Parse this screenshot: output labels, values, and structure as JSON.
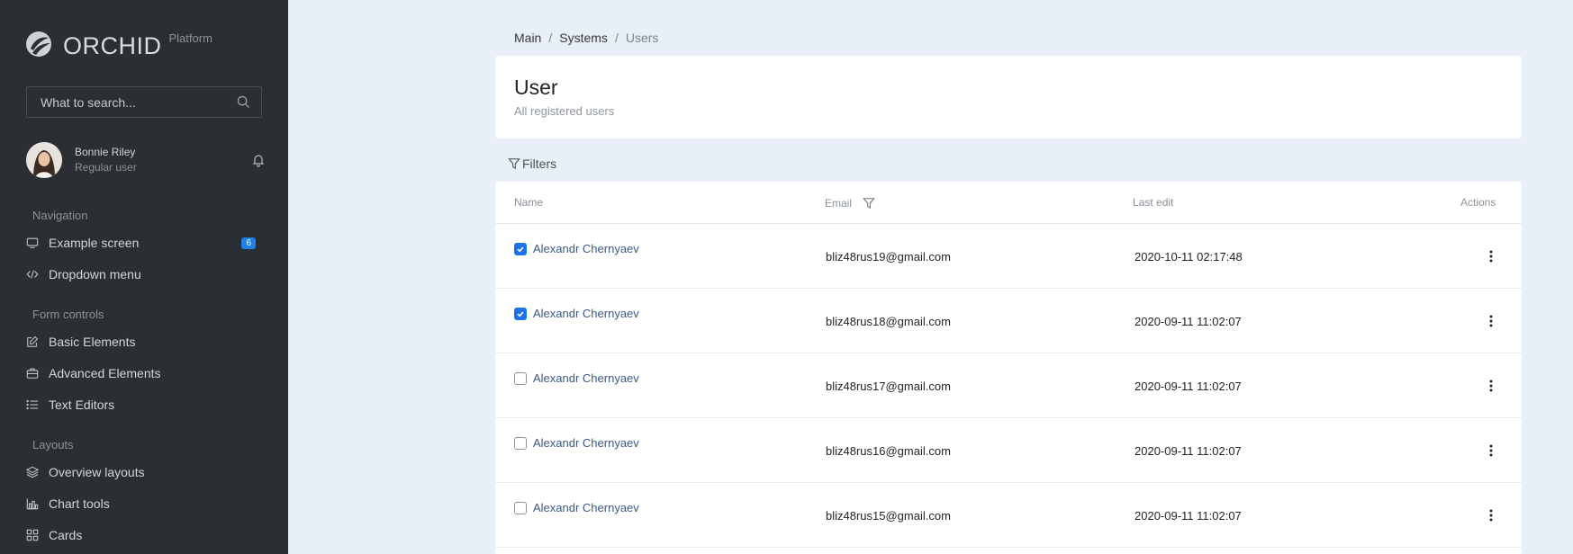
{
  "brand": {
    "name": "ORCHID",
    "sub": "Platform"
  },
  "search": {
    "placeholder": "What to search..."
  },
  "profile": {
    "name": "Bonnie Riley",
    "role": "Regular user"
  },
  "nav": {
    "section_navigation": "Navigation",
    "example_screen": "Example screen",
    "example_badge": "6",
    "dropdown_menu": "Dropdown menu",
    "section_forms": "Form controls",
    "basic_elements": "Basic Elements",
    "advanced_elements": "Advanced Elements",
    "text_editors": "Text Editors",
    "section_layouts": "Layouts",
    "overview_layouts": "Overview layouts",
    "chart_tools": "Chart tools",
    "cards": "Cards"
  },
  "breadcrumb": {
    "main": "Main",
    "systems": "Systems",
    "users": "Users",
    "separator": "/"
  },
  "header": {
    "title": "User",
    "subtitle": "All registered users"
  },
  "filters_label": "Filters",
  "table": {
    "columns": {
      "name": "Name",
      "email": "Email",
      "last_edit": "Last edit",
      "actions": "Actions"
    },
    "rows": [
      {
        "name": "Alexandr Chernyaev",
        "email": "bliz48rus19@gmail.com",
        "last_edit": "2020-10-11 02:17:48",
        "checked": true
      },
      {
        "name": "Alexandr Chernyaev",
        "email": "bliz48rus18@gmail.com",
        "last_edit": "2020-09-11 11:02:07",
        "checked": true
      },
      {
        "name": "Alexandr Chernyaev",
        "email": "bliz48rus17@gmail.com",
        "last_edit": "2020-09-11 11:02:07",
        "checked": false
      },
      {
        "name": "Alexandr Chernyaev",
        "email": "bliz48rus16@gmail.com",
        "last_edit": "2020-09-11 11:02:07",
        "checked": false
      },
      {
        "name": "Alexandr Chernyaev",
        "email": "bliz48rus15@gmail.com",
        "last_edit": "2020-09-11 11:02:07",
        "checked": false
      }
    ]
  },
  "colors": {
    "sidebar_bg": "#2b2f33",
    "page_bg": "#e9eff6",
    "accent": "#1a73e8",
    "badge": "#1f80e6"
  },
  "icons": [
    "orchid-logo-icon",
    "search-icon",
    "bell-icon",
    "monitor-icon",
    "code-icon",
    "edit-icon",
    "briefcase-icon",
    "list-icon",
    "layers-icon",
    "bar-chart-icon",
    "grid-icon",
    "filter-icon",
    "check-icon",
    "kebab-menu-icon"
  ]
}
